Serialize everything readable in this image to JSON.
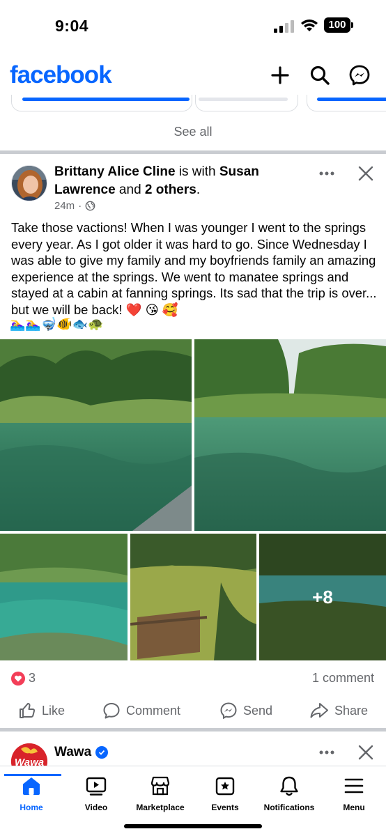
{
  "status_bar": {
    "time": "9:04",
    "battery": "100"
  },
  "header": {
    "logo": "facebook",
    "icons": [
      "plus-icon",
      "search-icon",
      "messenger-icon"
    ]
  },
  "stories": {
    "see_all": "See all"
  },
  "post": {
    "author": "Brittany Alice Cline",
    "with_text": " is with ",
    "tagged_person": "Susan Lawrence",
    "and_text": " and ",
    "others": "2 others",
    "period": ".",
    "time": "24m",
    "privacy_separator": "·",
    "privacy_icon": "globe-icon",
    "text": "Take those vactions! When I was younger I went to the springs every year. As I got older it was hard to go. Since Wednesday I was able to give my family and my boyfriends family an amazing experience at the springs. We went to manatee springs and stayed at a cabin at fanning springs. Its sad that the trip is over... but we will be back! ❤️ 😘 🥰",
    "emoji_line": "🏊‍♀️🏊‍♀️🤿🐠🐟🐢",
    "more_photos": "+8",
    "reactions": {
      "count": "3",
      "type": "love"
    },
    "comments": "1 comment",
    "actions": {
      "like": "Like",
      "comment": "Comment",
      "send": "Send",
      "share": "Share"
    }
  },
  "next_post": {
    "author": "Wawa",
    "logo_text": "Wawa"
  },
  "bottom_nav": {
    "home": "Home",
    "video": "Video",
    "marketplace": "Marketplace",
    "events": "Events",
    "notifications": "Notifications",
    "menu": "Menu"
  },
  "colors": {
    "brand": "#0866ff",
    "love": "#f33e58",
    "secondary_text": "#65676b"
  }
}
